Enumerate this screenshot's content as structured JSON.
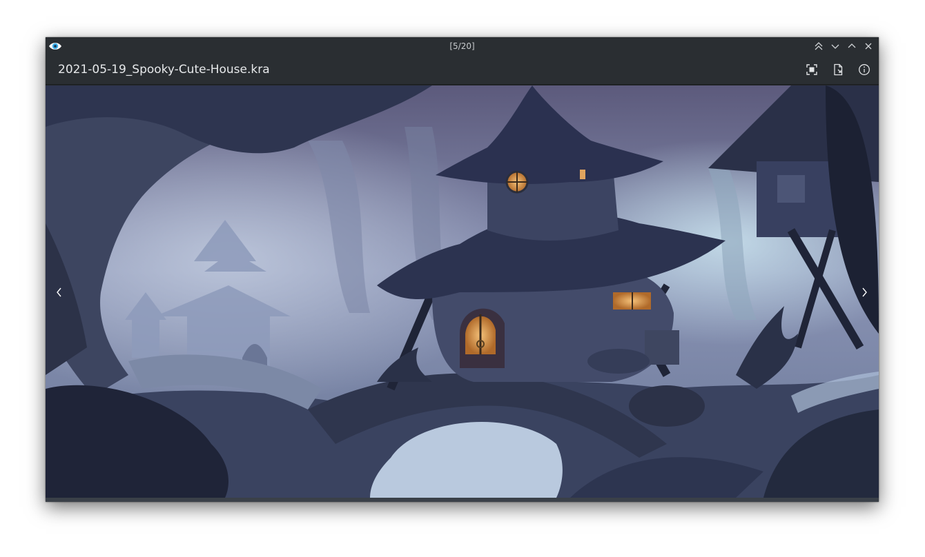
{
  "window": {
    "counter": "[5/20]",
    "app_icon": "eye-icon",
    "controls": [
      "keep-above-icon",
      "minimize-icon",
      "maximize-icon",
      "close-icon"
    ]
  },
  "header": {
    "filename": "2021-05-19_Spooky-Cute-House.kra",
    "actions": [
      "fullscreen-icon",
      "open-file-icon",
      "info-icon"
    ]
  },
  "viewer": {
    "prev_icon": "chevron-left-icon",
    "next_icon": "chevron-right-icon",
    "image_description": "painting of a spooky cute house in a misty forest"
  },
  "colors": {
    "titlebar": "#2a2e32",
    "accent": "#3daee9"
  }
}
